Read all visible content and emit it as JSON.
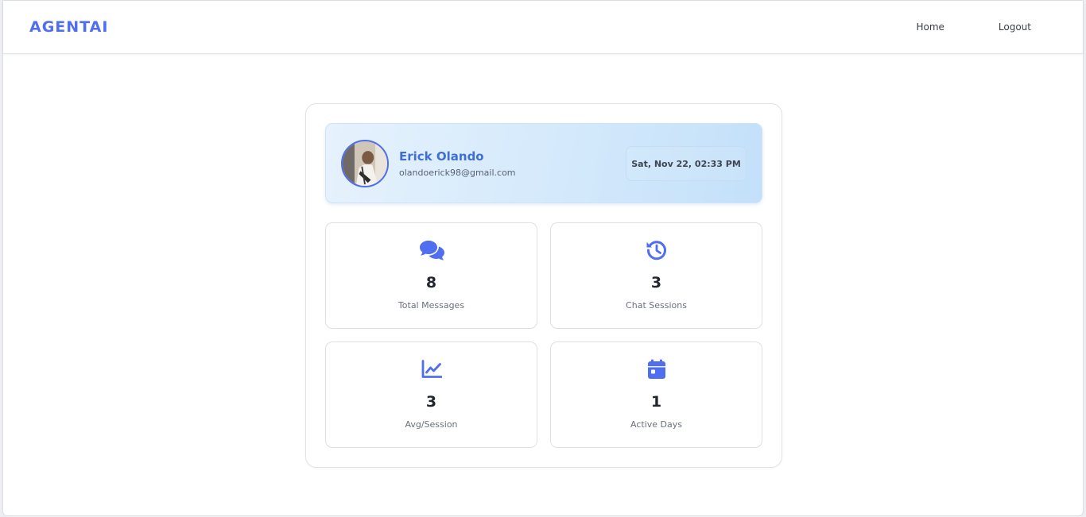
{
  "navbar": {
    "brand": "AGENTAI",
    "links": [
      {
        "label": "Home"
      },
      {
        "label": "Logout"
      }
    ]
  },
  "profile": {
    "name": "Erick Olando",
    "email": "olandoerick98@gmail.com",
    "datetime": "Sat, Nov 22, 02:33 PM",
    "avatar_icon": "user-photo"
  },
  "stats": [
    {
      "icon": "comments-icon",
      "value": "8",
      "label": "Total Messages"
    },
    {
      "icon": "history-icon",
      "value": "3",
      "label": "Chat Sessions"
    },
    {
      "icon": "chart-line-icon",
      "value": "3",
      "label": "Avg/Session"
    },
    {
      "icon": "calendar-icon",
      "value": "1",
      "label": "Active Days"
    }
  ],
  "colors": {
    "accent": "#4f6ef0",
    "name": "#3f6fd6",
    "profile_bg": "#d2e8fb"
  }
}
